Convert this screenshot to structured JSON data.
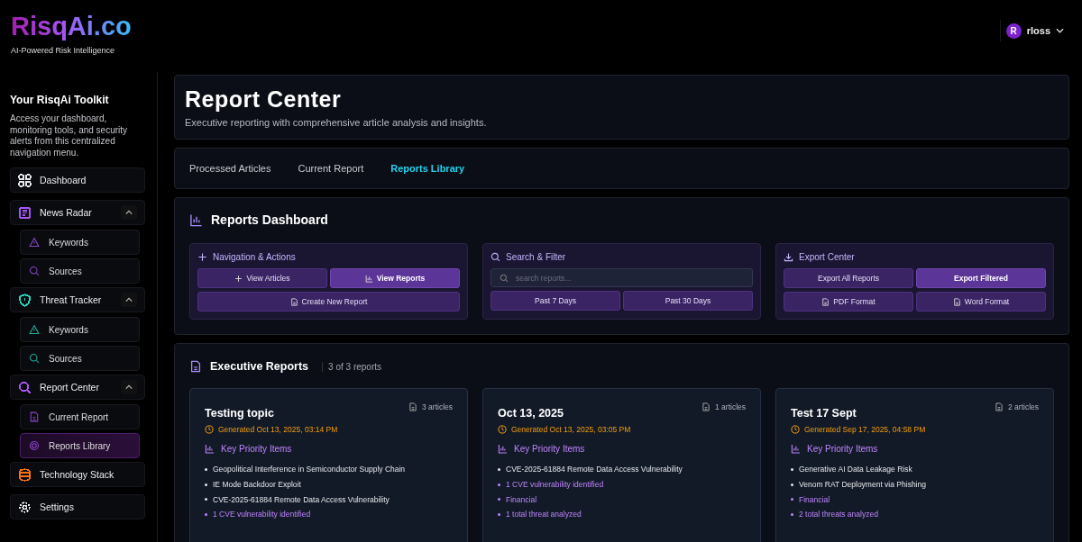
{
  "brand": {
    "logo": "RisqAi.co",
    "tagline": "AI-Powered Risk Intelligence"
  },
  "user": {
    "initial": "R",
    "name": "rloss"
  },
  "sidebar": {
    "title": "Your RisqAi Toolkit",
    "description": "Access your dashboard, monitoring tools, and security alerts from this centralized navigation menu.",
    "items": [
      {
        "label": "Dashboard",
        "kind": "link",
        "color": "#e5e7eb"
      },
      {
        "label": "News Radar",
        "kind": "group",
        "expanded": true,
        "color": "#a855f7",
        "children": [
          {
            "label": "Keywords",
            "selected": false
          },
          {
            "label": "Sources",
            "selected": false
          }
        ]
      },
      {
        "label": "Threat Tracker",
        "kind": "group",
        "expanded": true,
        "color": "#2dd4bf",
        "children": [
          {
            "label": "Keywords",
            "selected": false
          },
          {
            "label": "Sources",
            "selected": false
          }
        ]
      },
      {
        "label": "Report Center",
        "kind": "group",
        "expanded": true,
        "color": "#a855f7",
        "children": [
          {
            "label": "Current Report",
            "selected": false
          },
          {
            "label": "Reports Library",
            "selected": true
          }
        ]
      },
      {
        "label": "Technology Stack",
        "kind": "link",
        "color": "#f97316"
      },
      {
        "label": "Settings",
        "kind": "link",
        "color": "#e5e7eb"
      }
    ]
  },
  "page": {
    "title": "Report Center",
    "subtitle": "Executive reporting with comprehensive article analysis and insights."
  },
  "tabs": [
    {
      "label": "Processed Articles",
      "selected": false
    },
    {
      "label": "Current Report",
      "selected": false
    },
    {
      "label": "Reports Library",
      "selected": true
    }
  ],
  "dashboard": {
    "title": "Reports Dashboard",
    "panels": [
      {
        "title": "Navigation & Actions",
        "buttons": [
          {
            "label": "View Articles",
            "active": false
          },
          {
            "label": "View Reports",
            "active": true
          },
          {
            "label": "Create New Report",
            "active": false
          }
        ]
      },
      {
        "title": "Search & Filter",
        "search": {
          "placeholder": "search reports..."
        },
        "buttons": [
          {
            "label": "Past 7 Days",
            "active": false
          },
          {
            "label": "Past 30 Days",
            "active": false
          }
        ]
      },
      {
        "title": "Export Center",
        "buttons": [
          {
            "label": "Export All Reports",
            "active": false
          },
          {
            "label": "Export Filtered",
            "active": true
          },
          {
            "label": "PDF Format",
            "active": false
          },
          {
            "label": "Word Format",
            "active": false
          }
        ]
      }
    ]
  },
  "reports": {
    "title": "Executive Reports",
    "count": "3 of 3 reports",
    "cards": [
      {
        "title": "Testing topic",
        "articles": "3 articles",
        "generated": "Generated Oct 13, 2025, 03:14 PM",
        "section": "Key Priority Items",
        "items": [
          {
            "text": "Geopolitical Interference in Semiconductor Supply Chain",
            "kind": "item"
          },
          {
            "text": "IE Mode Backdoor Exploit",
            "kind": "item"
          },
          {
            "text": "CVE-2025-61884 Remote Data Access Vulnerability",
            "kind": "item"
          },
          {
            "text": "1 CVE vulnerability identified",
            "kind": "stat"
          }
        ]
      },
      {
        "title": "Oct 13, 2025",
        "articles": "1 articles",
        "generated": "Generated Oct 13, 2025, 03:05 PM",
        "section": "Key Priority Items",
        "items": [
          {
            "text": "CVE-2025-61884 Remote Data Access Vulnerability",
            "kind": "item"
          },
          {
            "text": "1 CVE vulnerability identified",
            "kind": "stat"
          },
          {
            "text": "Financial",
            "kind": "stat"
          },
          {
            "text": "1 total threat analyzed",
            "kind": "stat"
          }
        ]
      },
      {
        "title": "Test 17 Sept",
        "articles": "2 articles",
        "generated": "Generated Sep 17, 2025, 04:58 PM",
        "section": "Key Priority Items",
        "items": [
          {
            "text": "Generative AI Data Leakage Risk",
            "kind": "item"
          },
          {
            "text": "Venom RAT Deployment via Phishing",
            "kind": "item"
          },
          {
            "text": "Financial",
            "kind": "stat"
          },
          {
            "text": "2 total threats analyzed",
            "kind": "stat"
          }
        ]
      }
    ]
  }
}
